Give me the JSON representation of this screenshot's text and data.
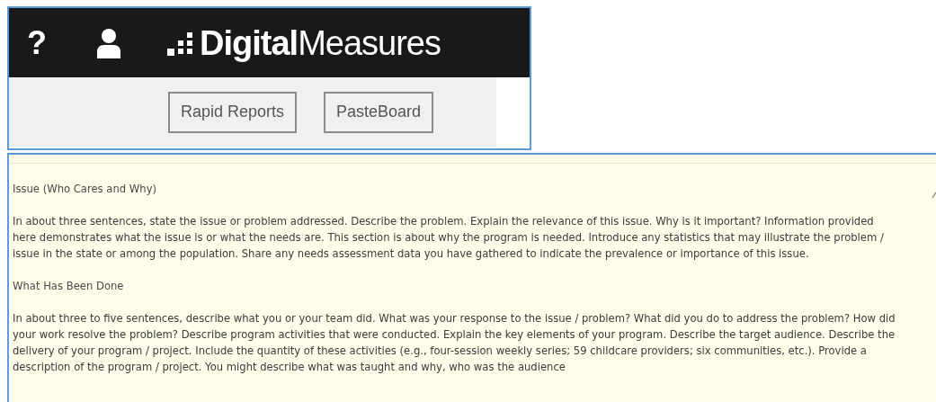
{
  "header": {
    "help": "?",
    "logo_bold": "Digital",
    "logo_light": "Measures"
  },
  "toolbar": {
    "buttons": [
      "Rapid Reports",
      "PasteBoard"
    ]
  },
  "form": {
    "sections": [
      {
        "kind": "heading",
        "text": "Issue (Who Cares and Why)"
      },
      {
        "kind": "paragraph",
        "text": "In about three sentences, state the issue or problem addressed. Describe the problem. Explain the relevance of this issue. Why is it important? Information provided here demonstrates what the issue is or what the needs are. This section is about why the program is needed. Introduce any statistics that may illustrate the problem / issue in the state or among the population. Share any needs assessment data you have gathered to indicate the prevalence or importance of this issue."
      },
      {
        "kind": "heading",
        "text": "What Has Been Done"
      },
      {
        "kind": "paragraph",
        "text": "In about three to five sentences, describe what you or your team did. What was your response to the issue / problem? What did you do to address the problem? How did your work resolve the problem? Describe program activities that were conducted. Explain the key elements of your program. Describe the target audience. Describe the delivery of your program / project. Include the quantity of these activities (e.g., four-session weekly series; 59 childcare providers; six communities, etc.). Provide a description of the program / project. You might describe what was taught and why, who was the audience"
      }
    ]
  }
}
